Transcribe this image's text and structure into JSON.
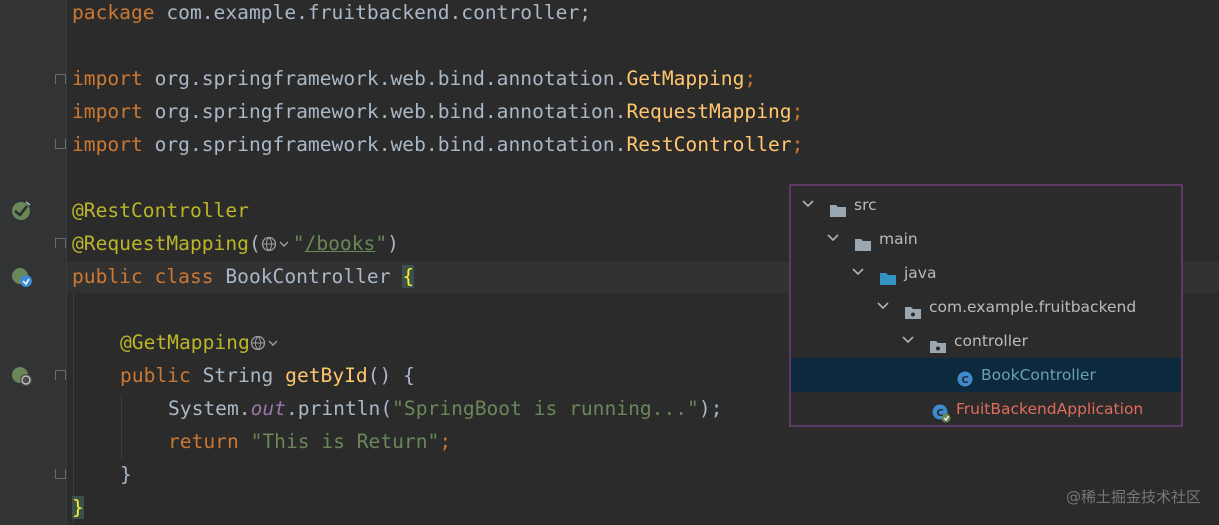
{
  "code": {
    "line1": {
      "kw": "package",
      "rest": " com.example.fruitbackend.controller;"
    },
    "line3": {
      "kw": "import",
      "pkg": " org.springframework.web.bind.annotation.",
      "cls": "GetMapping",
      "end": ";"
    },
    "line4": {
      "kw": "import",
      "pkg": " org.springframework.web.bind.annotation.",
      "cls": "RequestMapping",
      "end": ";"
    },
    "line5": {
      "kw": "import",
      "pkg": " org.springframework.web.bind.annotation.",
      "cls": "RestController",
      "end": ";"
    },
    "line7": {
      "anno": "@RestController"
    },
    "line8": {
      "anno": "@RequestMapping",
      "open": "(",
      "q1": "\"",
      "url": "/books",
      "q2": "\"",
      "close": ")"
    },
    "line9": {
      "kw": "public class",
      "name": " BookController ",
      "brace": "{"
    },
    "line11": {
      "anno": "@GetMapping"
    },
    "line12": {
      "kw": "public",
      "type": " String ",
      "fn": "getById",
      "rest": "() {"
    },
    "line13": {
      "obj": "System.",
      "field": "out",
      "call": ".println(",
      "str": "\"SpringBoot is running...\"",
      "end": ");"
    },
    "line14": {
      "kw": "return",
      "sp": " ",
      "str": "\"This is Return\"",
      "end": ";"
    },
    "line15": {
      "brace": "}"
    },
    "line16": {
      "brace": "}"
    }
  },
  "tree": {
    "items": [
      {
        "label": "src",
        "type": "folder"
      },
      {
        "label": "main",
        "type": "folder"
      },
      {
        "label": "java",
        "type": "source-folder"
      },
      {
        "label": "com.example.fruitbackend",
        "type": "package"
      },
      {
        "label": "controller",
        "type": "package"
      },
      {
        "label": "BookController",
        "type": "class",
        "selected": true
      },
      {
        "label": "FruitBackendApplication",
        "type": "spring-class"
      }
    ]
  },
  "watermark": "@稀土掘金技术社区",
  "colors": {
    "keyword": "#cc7832",
    "annotation": "#bbb529",
    "string": "#6a8759",
    "method": "#ffc66d",
    "field": "#9876aa",
    "selection": "#0d293e",
    "border": "#5c3a63"
  }
}
